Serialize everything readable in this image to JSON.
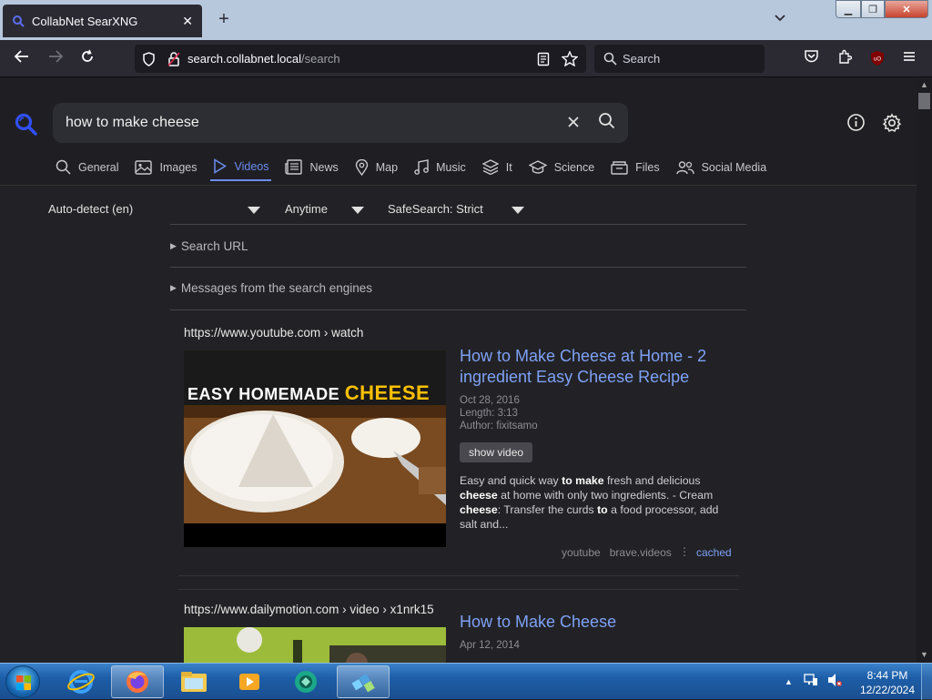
{
  "browser": {
    "tab_title": "CollabNet SearXNG",
    "url_host": "search.collabnet.local",
    "url_path": "/search",
    "search_placeholder": "Search"
  },
  "header": {
    "query": "how to make cheese",
    "categories": [
      {
        "label": "General",
        "icon": "search-icon",
        "active": false
      },
      {
        "label": "Images",
        "icon": "image-icon",
        "active": false
      },
      {
        "label": "Videos",
        "icon": "play-icon",
        "active": true
      },
      {
        "label": "News",
        "icon": "newspaper-icon",
        "active": false
      },
      {
        "label": "Map",
        "icon": "map-pin-icon",
        "active": false
      },
      {
        "label": "Music",
        "icon": "music-icon",
        "active": false
      },
      {
        "label": "It",
        "icon": "layers-icon",
        "active": false
      },
      {
        "label": "Science",
        "icon": "graduation-cap-icon",
        "active": false
      },
      {
        "label": "Files",
        "icon": "file-box-icon",
        "active": false
      },
      {
        "label": "Social Media",
        "icon": "people-icon",
        "active": false
      }
    ]
  },
  "filters": {
    "language": "Auto-detect (en)",
    "time_range": "Anytime",
    "safesearch": "SafeSearch: Strict"
  },
  "expanders": {
    "search_url": "Search URL",
    "messages": "Messages from the search engines"
  },
  "results": [
    {
      "url_host": "https://www.youtube.com",
      "url_path": "› watch",
      "thumb_text_a": "EASY HOMEMADE",
      "thumb_text_b": "CHEESE",
      "title": "How to Make Cheese at Home - 2 ingredient Easy Cheese Recipe",
      "date": "Oct 28, 2016",
      "length": "Length: 3:13",
      "author": "Author: fixitsamo",
      "show_video": "show video",
      "snippet_parts": [
        "Easy and quick way ",
        "to make",
        " fresh and delicious ",
        "cheese",
        " at home with only two ingredients. - Cream ",
        "cheese",
        ": Transfer the curds ",
        "to",
        " a food processor, add salt and..."
      ],
      "engines": [
        "youtube",
        "brave.videos"
      ],
      "cached": "cached"
    },
    {
      "url_host": "https://www.dailymotion.com",
      "url_path": "› video › x1nrk15",
      "title": "How to Make Cheese",
      "date": "Apr 12, 2014"
    }
  ],
  "taskbar": {
    "time": "8:44 PM",
    "date": "12/22/2024"
  },
  "colors": {
    "accent": "#6b8cf0",
    "link": "#7ea1f5",
    "page_bg": "#222226"
  }
}
